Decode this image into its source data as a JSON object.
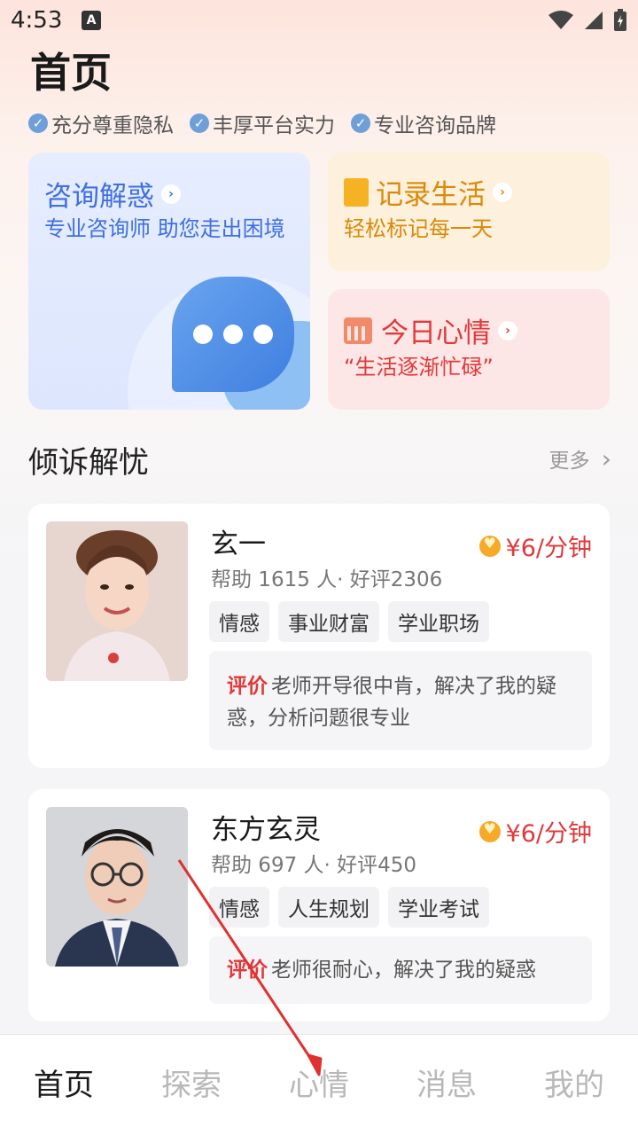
{
  "status_bar": {
    "time": "4:53",
    "indicator": "A"
  },
  "page": {
    "title": "首页"
  },
  "badges": [
    "充分尊重隐私",
    "丰厚平台实力",
    "专业咨询品牌"
  ],
  "cards": {
    "consult": {
      "title": "咨询解惑",
      "subtitle": "专业咨询师 助您走出困境"
    },
    "record": {
      "title": "记录生活",
      "subtitle": "轻松标记每一天"
    },
    "mood": {
      "title": "今日心情",
      "subtitle": "“生活逐渐忙碌”"
    }
  },
  "section": {
    "title": "倾诉解忧",
    "more": "更多"
  },
  "consultants": [
    {
      "name": "玄一",
      "stats": "帮助 1615 人· 好评2306",
      "price": "¥6/分钟",
      "tags": [
        "情感",
        "事业财富",
        "学业职场"
      ],
      "review_label": "评价",
      "review": "老师开导很中肯，解决了我的疑惑，分析问题很专业"
    },
    {
      "name": "东方玄灵",
      "stats": "帮助 697 人· 好评450",
      "price": "¥6/分钟",
      "tags": [
        "情感",
        "人生规划",
        "学业考试"
      ],
      "review_label": "评价",
      "review": "老师很耐心，解决了我的疑惑"
    }
  ],
  "nav": {
    "items": [
      "首页",
      "探索",
      "心情",
      "消息",
      "我的"
    ],
    "active": "首页"
  },
  "colors": {
    "accent_red": "#e0393b",
    "accent_blue": "#3f6fe0",
    "accent_orange": "#d98a0a"
  }
}
